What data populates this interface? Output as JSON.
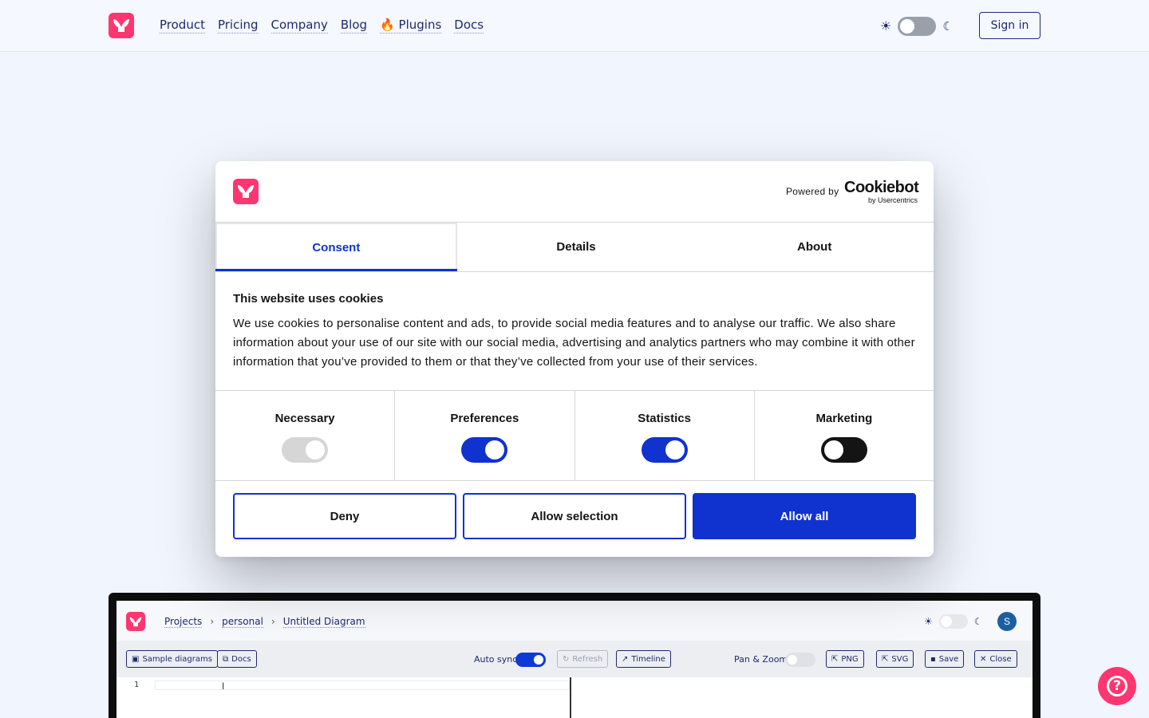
{
  "nav": {
    "links": [
      "Product",
      "Pricing",
      "Company",
      "Blog",
      "Plugins",
      "Docs"
    ],
    "plugins_emoji": "🔥",
    "signin_label": "Sign in"
  },
  "colors": {
    "brand_pink": "#ff3670",
    "cookiebot_blue": "#1032cf",
    "nav_text": "#1e2a6e"
  },
  "dialog": {
    "powered_by": "Powered by",
    "brand_name": "Cookiebot",
    "brand_sub": "by Usercentrics",
    "tabs": [
      {
        "label": "Consent",
        "active": true
      },
      {
        "label": "Details",
        "active": false
      },
      {
        "label": "About",
        "active": false
      }
    ],
    "title": "This website uses cookies",
    "text": "We use cookies to personalise content and ads, to provide social media features and to analyse our traffic. We also share information about your use of our site with our social media, advertising and analytics partners who may combine it with other information that you’ve provided to them or that they’ve collected from your use of their services.",
    "categories": [
      {
        "label": "Necessary",
        "state": "disabled-on"
      },
      {
        "label": "Preferences",
        "state": "on"
      },
      {
        "label": "Statistics",
        "state": "on"
      },
      {
        "label": "Marketing",
        "state": "off"
      }
    ],
    "buttons": {
      "deny": "Deny",
      "allow_selection": "Allow selection",
      "allow_all": "Allow all"
    }
  },
  "preview": {
    "breadcrumbs": [
      "Projects",
      "personal",
      "Untitled Diagram"
    ],
    "avatar_initial": "S",
    "toolbar": {
      "sample_diagrams": "Sample diagrams",
      "docs": "Docs",
      "auto_sync": "Auto sync",
      "refresh": "Refresh",
      "timeline": "Timeline",
      "pan_zoom": "Pan & Zoom",
      "png": "PNG",
      "svg": "SVG",
      "save": "Save",
      "close": "Close"
    },
    "line_number": "1"
  }
}
